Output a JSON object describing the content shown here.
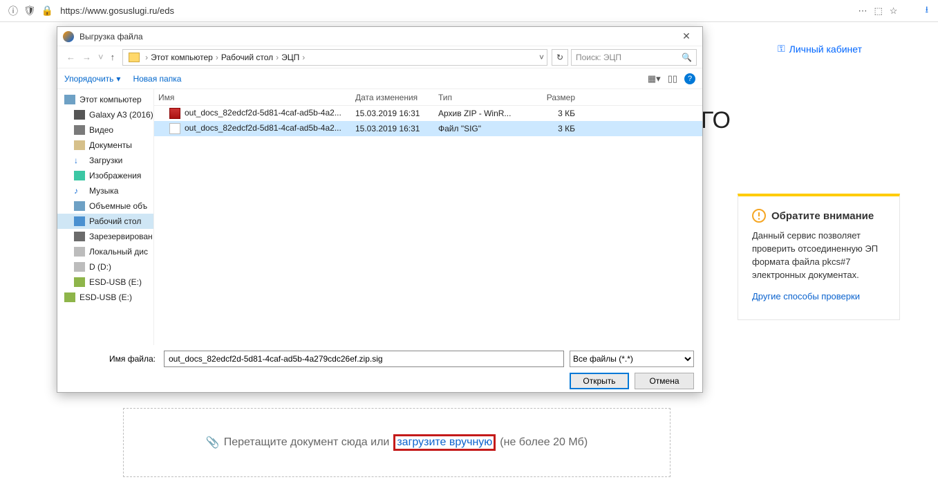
{
  "browser": {
    "url": "https://www.gosuslugi.ru/eds",
    "account_link": "Личный кабинет",
    "big_letters": "ГО"
  },
  "dropzone": {
    "attach_icon": "📎",
    "text_before": "Перетащите документ сюда или",
    "link_text": "загрузите вручную",
    "text_after": "(не более 20 Мб)"
  },
  "info_panel": {
    "title": "Обратите внимание",
    "body": "Данный сервис позволяет проверить отсоединенную ЭП формата файла pkcs#7 электронных документах.",
    "link": "Другие способы проверки"
  },
  "dialog": {
    "title": "Выгрузка файла",
    "breadcrumbs": [
      "Этот компьютер",
      "Рабочий стол",
      "ЭЦП"
    ],
    "refresh": "↻",
    "search_placeholder": "Поиск: ЭЦП",
    "toolbar": {
      "organize": "Упорядочить",
      "new_folder": "Новая папка"
    },
    "tree": [
      {
        "label": "Этот компьютер",
        "icon": "i-pc"
      },
      {
        "label": "Galaxy A3 (2016)",
        "icon": "i-ph"
      },
      {
        "label": "Видео",
        "icon": "i-vid"
      },
      {
        "label": "Документы",
        "icon": "i-doc"
      },
      {
        "label": "Загрузки",
        "icon": "i-dl"
      },
      {
        "label": "Изображения",
        "icon": "i-img"
      },
      {
        "label": "Музыка",
        "icon": "i-mus"
      },
      {
        "label": "Объемные объ",
        "icon": "i-vol"
      },
      {
        "label": "Рабочий стол",
        "icon": "i-desk",
        "selected": true
      },
      {
        "label": "Зарезервирован",
        "icon": "i-bak"
      },
      {
        "label": "Локальный дис",
        "icon": "i-disk"
      },
      {
        "label": "D (D:)",
        "icon": "i-disk"
      },
      {
        "label": "ESD-USB (E:)",
        "icon": "i-usb"
      },
      {
        "label": "ESD-USB (E:)",
        "icon": "i-usb"
      }
    ],
    "columns": {
      "name": "Имя",
      "date": "Дата изменения",
      "type": "Тип",
      "size": "Размер"
    },
    "files": [
      {
        "icon": "zip",
        "name": "out_docs_82edcf2d-5d81-4caf-ad5b-4a2...",
        "date": "15.03.2019 16:31",
        "type": "Архив ZIP - WinR...",
        "size": "3 КБ",
        "selected": false
      },
      {
        "icon": "sig",
        "name": "out_docs_82edcf2d-5d81-4caf-ad5b-4a2...",
        "date": "15.03.2019 16:31",
        "type": "Файл \"SIG\"",
        "size": "3 КБ",
        "selected": true
      }
    ],
    "filename_label": "Имя файла:",
    "filename_value": "out_docs_82edcf2d-5d81-4caf-ad5b-4a279cdc26ef.zip.sig",
    "filter_value": "Все файлы (*.*)",
    "open": "Открыть",
    "cancel": "Отмена"
  }
}
